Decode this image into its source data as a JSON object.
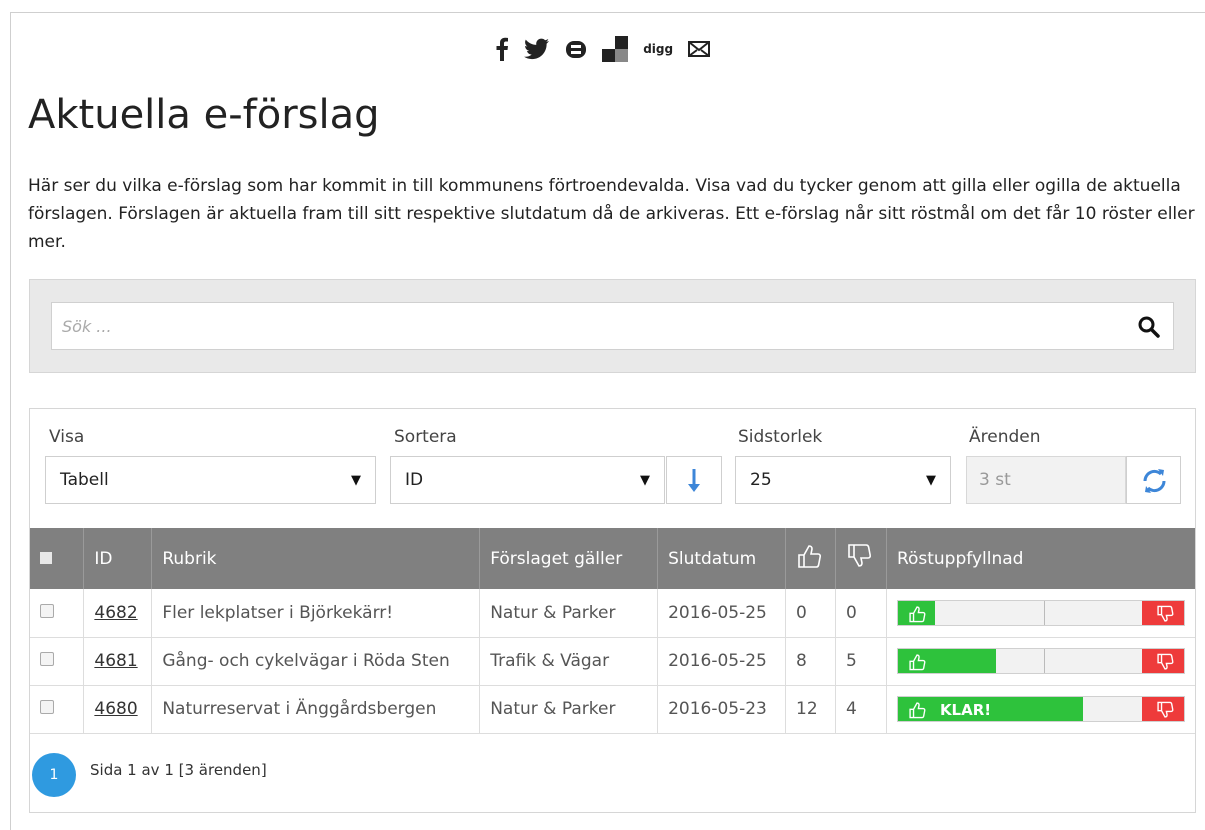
{
  "social": {
    "icons": [
      "facebook-icon",
      "twitter-icon",
      "bloglovin-icon",
      "delicious-icon",
      "digg-icon",
      "email-icon"
    ],
    "digg_label": "digg"
  },
  "page": {
    "title": "Aktuella e-förslag",
    "intro": "Här ser du vilka e-förslag som har kommit in till kommunens förtroendevalda. Visa vad du tycker genom att gilla eller ogilla de aktuella förslagen. Förslagen är aktuella fram till sitt respektive slutdatum då de arkiveras. Ett e-förslag når sitt röstmål om det får 10 röster eller mer."
  },
  "search": {
    "placeholder": "Sök ..."
  },
  "controls": {
    "view_label": "Visa",
    "view_value": "Tabell",
    "sort_label": "Sortera",
    "sort_value": "ID",
    "pagesize_label": "Sidstorlek",
    "pagesize_value": "25",
    "count_label": "Ärenden",
    "count_value": "3 st"
  },
  "table": {
    "headers": {
      "id": "ID",
      "title": "Rubrik",
      "category": "Förslaget gäller",
      "end_date": "Slutdatum",
      "progress": "Röstuppfyllnad"
    },
    "rows": [
      {
        "id": "4682",
        "title": "Fler lekplatser i Björkekärr!",
        "category": "Natur & Parker",
        "end_date": "2016-05-25",
        "likes": "0",
        "dislikes": "0",
        "fill": 0.15,
        "status": ""
      },
      {
        "id": "4681",
        "title": "Gång- och cykelvägar i Röda Sten",
        "category": "Trafik & Vägar",
        "end_date": "2016-05-25",
        "likes": "8",
        "dislikes": "5",
        "fill": 0.4,
        "status": ""
      },
      {
        "id": "4680",
        "title": "Naturreservat i Änggårdsbergen",
        "category": "Natur & Parker",
        "end_date": "2016-05-23",
        "likes": "12",
        "dislikes": "4",
        "fill": 0.75,
        "status": "KLAR!"
      }
    ]
  },
  "pager": {
    "current": "1",
    "info": "Sida 1 av 1 [3 ärenden]"
  },
  "colors": {
    "accent": "#2f9ae0",
    "like": "#2ec23c",
    "dislike": "#ee3b3b",
    "header": "#808080"
  }
}
